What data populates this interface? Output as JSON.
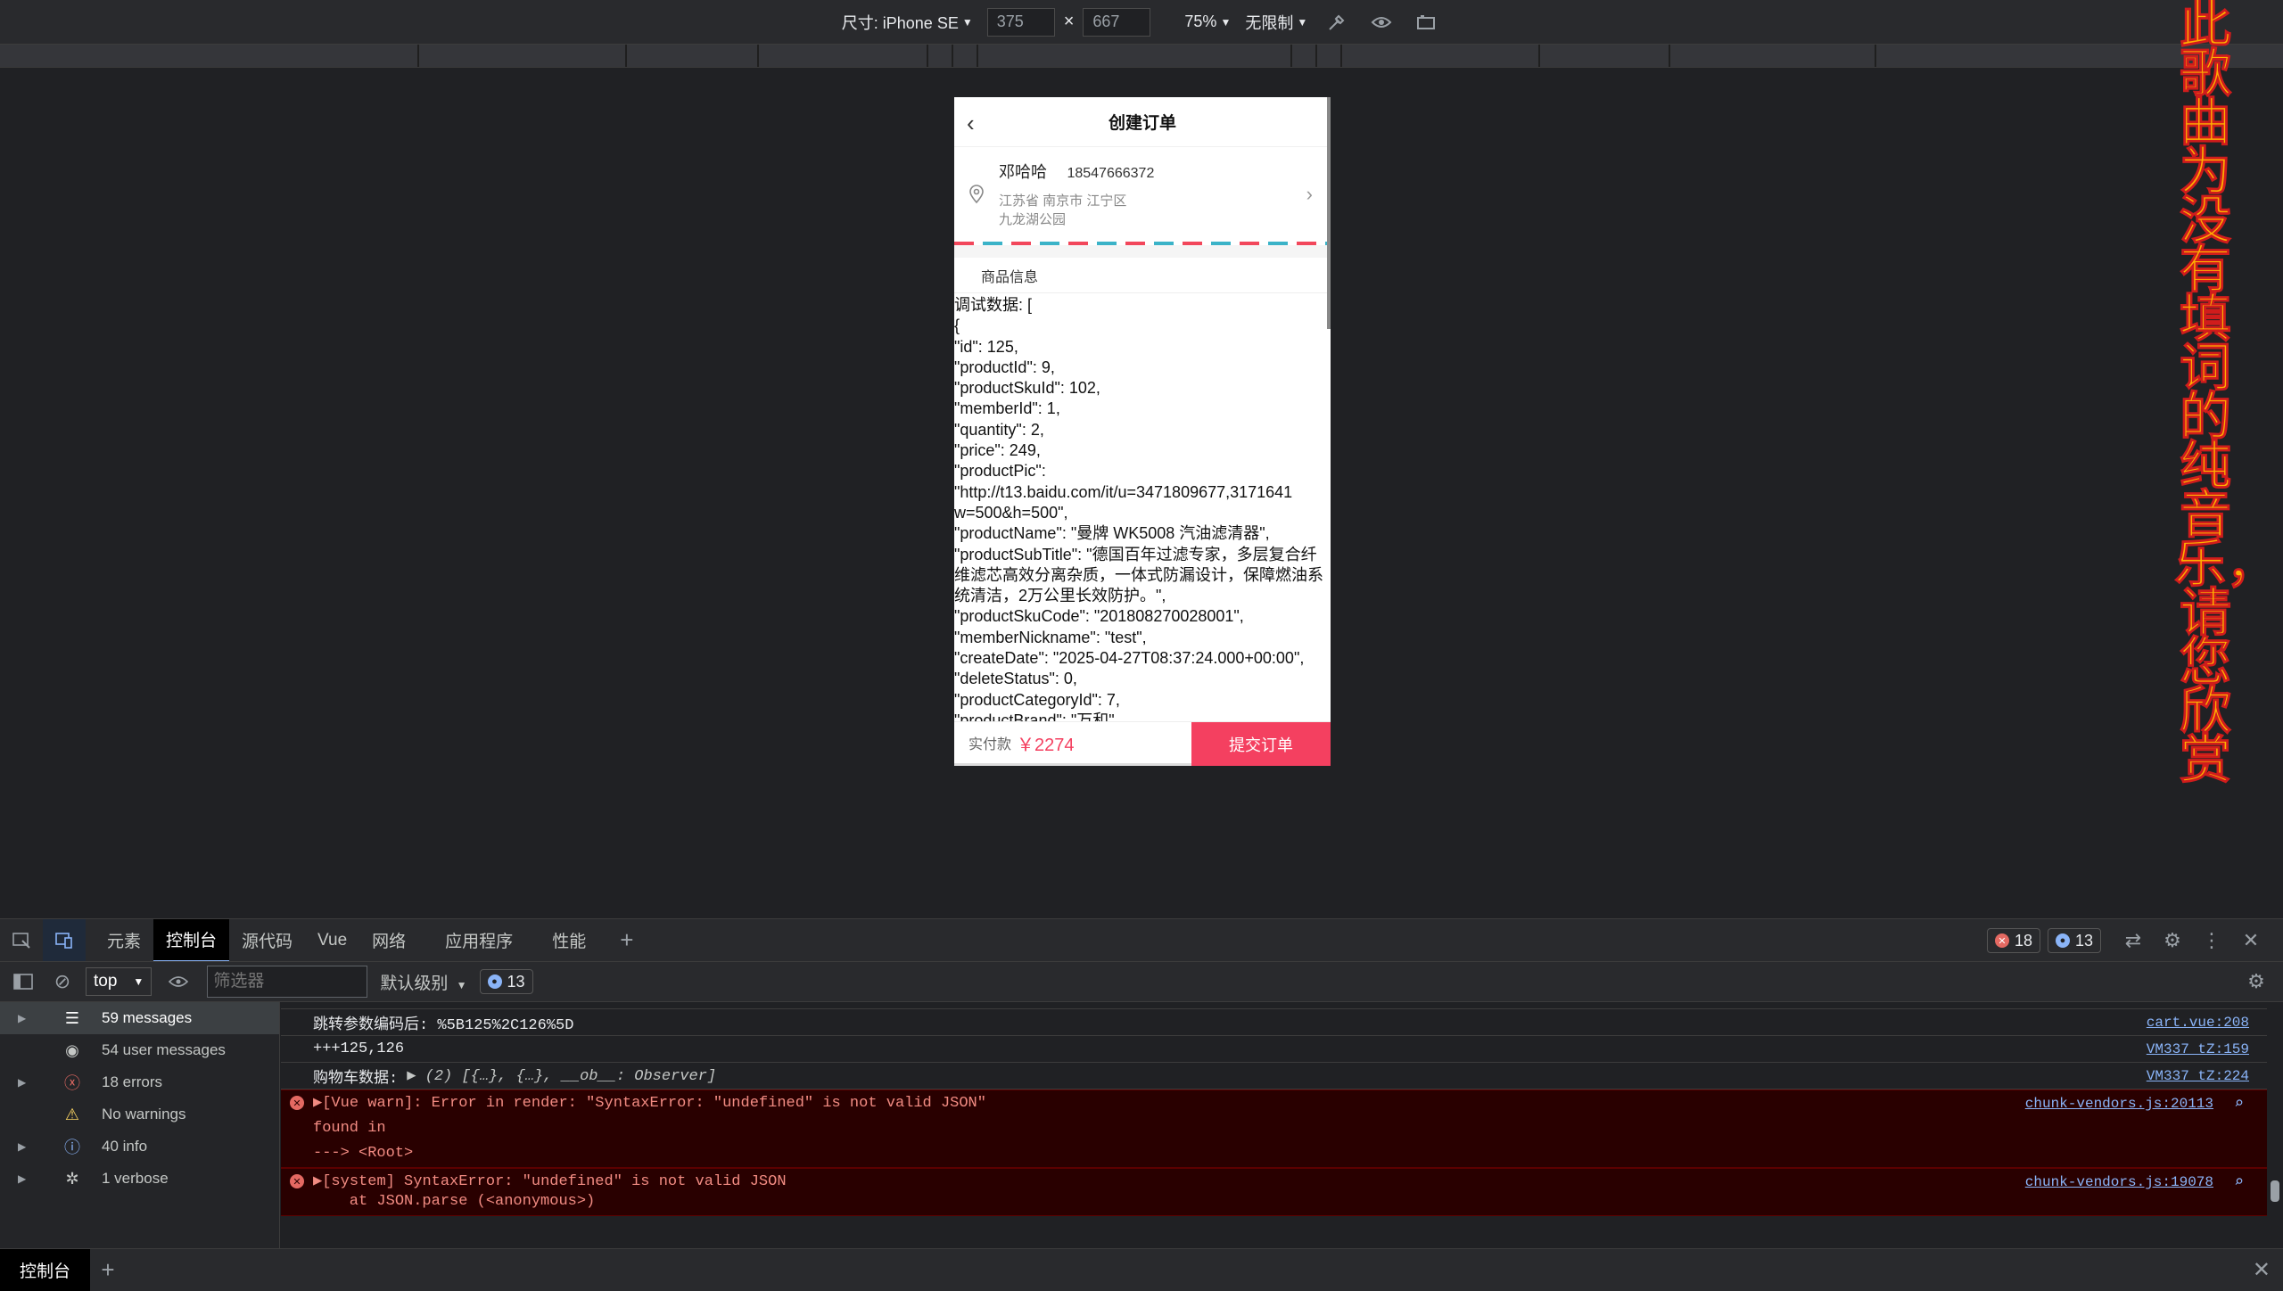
{
  "device_toolbar": {
    "dimensions_label": "尺寸: iPhone SE",
    "width": "375",
    "height": "667",
    "times": "×",
    "zoom": "75%",
    "throttle": "无限制"
  },
  "phone": {
    "title": "创建订单",
    "address": {
      "name": "邓哈哈",
      "phone": "18547666372",
      "line1": "江苏省 南京市 江宁区",
      "line2": "九龙湖公园"
    },
    "section_title": "商品信息",
    "debug_text": "调试数据: [\n{\n\"id\": 125,\n\"productId\": 9,\n\"productSkuId\": 102,\n\"memberId\": 1,\n\"quantity\": 2,\n\"price\": 249,\n\"productPic\":\n\"http://t13.baidu.com/it/u=3471809677,3171641\nw=500&h=500\",\n\"productName\": \"曼牌 WK5008 汽油滤清器\",\n\"productSubTitle\": \"德国百年过滤专家，多层复合纤\n维滤芯高效分离杂质，一体式防漏设计，保障燃油系\n统清洁，2万公里长效防护。\",\n\"productSkuCode\": \"201808270028001\",\n\"memberNickname\": \"test\",\n\"createDate\": \"2025-04-27T08:37:24.000+00:00\",\n\"deleteStatus\": 0,\n\"productCategoryId\": 7,\n\"productBrand\": \"万和\",",
    "pay_label": "实付款",
    "currency": "￥",
    "amount": "2274",
    "submit": "提交订单"
  },
  "lyric": "此歌曲为没有填词的纯音乐，请您欣赏",
  "devtools": {
    "tabs": [
      "元素",
      "控制台",
      "源代码",
      "Vue",
      "网络",
      "应用程序",
      "性能"
    ],
    "add_tab": "+",
    "error_count": "18",
    "info_count": "13",
    "context": "top",
    "filter_placeholder": "筛选器",
    "level": "默认级别",
    "filter_badge": "13",
    "sidebar": [
      {
        "label": "59 messages",
        "icon": "list-icon"
      },
      {
        "label": "54 user messages",
        "icon": "user-icon"
      },
      {
        "label": "18 errors",
        "icon": "error-icon"
      },
      {
        "label": "No warnings",
        "icon": "warning-icon"
      },
      {
        "label": "40 info",
        "icon": "info-icon"
      },
      {
        "label": "1 verbose",
        "icon": "bug-icon"
      }
    ],
    "console": {
      "row1": {
        "text": "跳转参数编码后: %5B125%2C126%5D",
        "src": "cart.vue:208"
      },
      "row2": {
        "text": "+++125,126",
        "src": "VM337 tZ:159"
      },
      "row3": {
        "prefix": "购物车数据:",
        "detail": "▶ (2) [{…}, {…}, __ob__: Observer]",
        "src": "VM337 tZ:224"
      },
      "err1": {
        "line1": "▶[Vue warn]: Error in render: \"SyntaxError: \"undefined\" is not valid JSON\"",
        "line2": "found in",
        "line3": "---> <Root>",
        "src": "chunk-vendors.js:20113"
      },
      "err2": {
        "line1": "▶[system] SyntaxError: \"undefined\" is not valid JSON",
        "line2": "    at JSON.parse (<anonymous>)",
        "src": "chunk-vendors.js:19078"
      }
    },
    "drawer_tab": "控制台"
  }
}
